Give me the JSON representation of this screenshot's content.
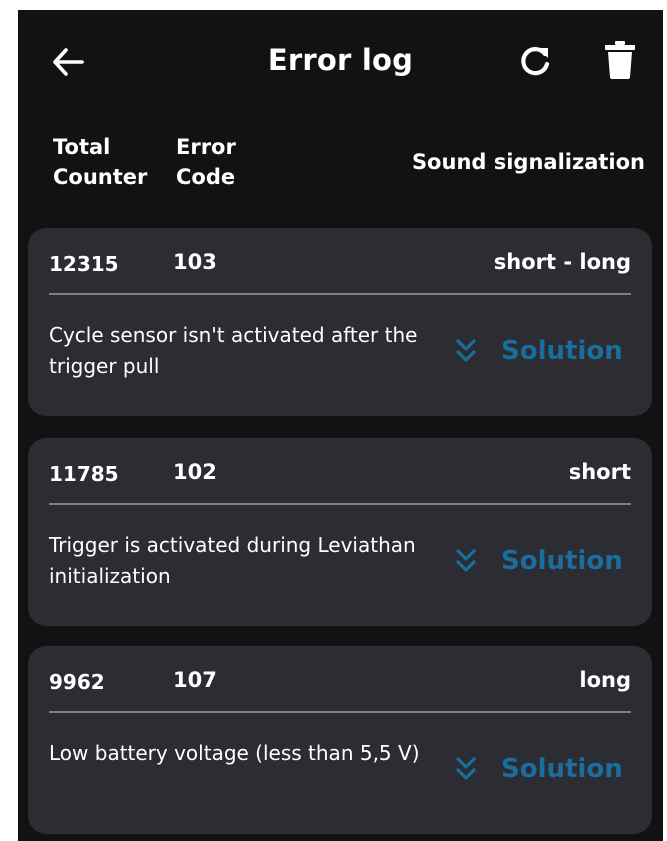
{
  "header": {
    "title": "Error log",
    "back_icon": "arrow-left-icon",
    "refresh_icon": "refresh-icon",
    "delete_icon": "trash-icon"
  },
  "columns": {
    "total_counter_line1": "Total",
    "total_counter_line2": "Counter",
    "error_code_line1": "Error",
    "error_code_line2": "Code",
    "sound": "Sound signalization"
  },
  "errors": [
    {
      "counter": "12315",
      "code": "103",
      "sound": "short - long",
      "description": "Cycle sensor isn't activated after the trigger pull",
      "solution_label": "Solution"
    },
    {
      "counter": "11785",
      "code": "102",
      "sound": "short",
      "description": "Trigger is activated during Leviathan initialization",
      "solution_label": "Solution"
    },
    {
      "counter": "9962",
      "code": "107",
      "sound": "long",
      "description": "Low battery voltage (less than 5,5 V)",
      "solution_label": "Solution"
    }
  ],
  "colors": {
    "background": "#121212",
    "card": "#2c2d33",
    "accent": "#1a6e9b",
    "text": "#ffffff"
  }
}
